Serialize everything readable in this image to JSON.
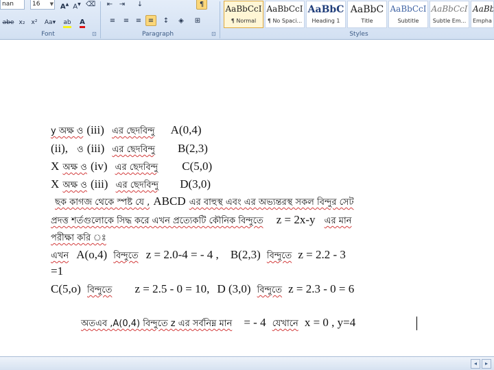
{
  "ribbon": {
    "font_group": {
      "font_name": "nan",
      "font_size": "16",
      "label": "Font",
      "row2": {
        "strike": "abe",
        "subscript": "x₂",
        "superscript": "x²",
        "change_case": "Aa"
      }
    },
    "paragraph_group": {
      "label": "Paragraph"
    },
    "styles_group": {
      "label": "Styles",
      "tiles": [
        {
          "sample": "AaBbCcI",
          "name": "¶ Normal"
        },
        {
          "sample": "AaBbCcI",
          "name": "¶ No Spaci..."
        },
        {
          "sample": "AaBbC",
          "name": "Heading 1"
        },
        {
          "sample": "AaBbC",
          "name": "Title"
        },
        {
          "sample": "AaBbCcI",
          "name": "Subtitle"
        },
        {
          "sample": "AaBbCcI",
          "name": "Subtle Em..."
        },
        {
          "sample": "AaBbCcI",
          "name": "Empha"
        }
      ]
    }
  },
  "document": {
    "lines": [
      {
        "bn": "y অক্ষ ও",
        "la": "(iii)",
        "bn2": "এর ছেদবিন্দু",
        "pt": "A(0,4)"
      },
      {
        "la0": "(ii),",
        "bn": "ও",
        "la": "(iii)",
        "bn2": "এর ছেদবিন্দু",
        "pt": "B(2,3)"
      },
      {
        "la0": "X",
        "bn": "অক্ষ ও",
        "la": "(iv)",
        "bn2": "এর ছেদবিন্দু",
        "pt": "C(5,0)"
      },
      {
        "la0": "X",
        "bn": "অক্ষ ও",
        "la": "(iii)",
        "bn2": "এর ছেদবিন্দু",
        "pt": "D(3,0)"
      }
    ],
    "para1_a": "ছক কাগজ থেকে স্পষ্ট যে ,",
    "para1_b": "ABCD",
    "para1_c": "এর বাহুস্থ এবং এর অভ্যন্তরস্থ সকল বিন্দুর সেট",
    "para2_a": "প্রদত্ত শর্তগুলোকে সিদ্ধ করে এখন প্রত্যেকটি কৌনিক বিন্দুতে",
    "para2_b": "z = 2x-y",
    "para2_c": "এর মান",
    "para3": "পরীক্ষা করি ঃ",
    "eval1_a": "এখন",
    "eval1_b": "A(o,4)",
    "eval1_c": "বিন্দুতে",
    "eval1_d": "z = 2.0-4 = - 4 ,",
    "eval1_e": "B(2,3)",
    "eval1_f": "বিন্দুতে",
    "eval1_g": "z = 2.2 - 3",
    "eval2": "=1",
    "eval3_a": "C(5,o)",
    "eval3_b": "বিন্দুতে",
    "eval3_c": "z = 2.5 - 0 = 10,",
    "eval3_d": "D (3,0)",
    "eval3_e": "বিন্দুতে",
    "eval3_f": "z = 2.3 - 0 = 6",
    "concl_a": "অতএব ,A(0,4) বিন্দুতে z এর সর্বনিম্ন মান",
    "concl_b": "= - 4",
    "concl_c": "যেখানে",
    "concl_d": "x = 0 , y=4"
  }
}
